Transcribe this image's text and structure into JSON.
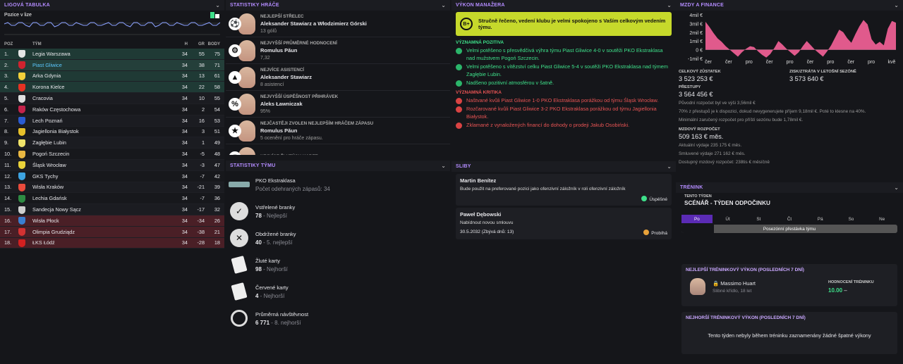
{
  "league": {
    "title": "LIGOVÁ TABULKA",
    "position_label": "Pozice v lize",
    "cols": {
      "pos": "POZ",
      "team": "TÝM",
      "p": "H",
      "gd": "GR",
      "pts": "BODY"
    },
    "rows": [
      {
        "pos": "1.",
        "team": "Legia Warszawa",
        "p": "34",
        "gd": "55",
        "pts": "75",
        "zone": "g",
        "crest": "#e5e5e5"
      },
      {
        "pos": "2.",
        "team": "Piast Gliwice",
        "p": "34",
        "gd": "38",
        "pts": "71",
        "zone": "gd",
        "crest": "#d0232f",
        "hl": true
      },
      {
        "pos": "3.",
        "team": "Arka Gdynia",
        "p": "34",
        "gd": "13",
        "pts": "61",
        "zone": "g",
        "crest": "#f2d03b"
      },
      {
        "pos": "4.",
        "team": "Korona Kielce",
        "p": "34",
        "gd": "22",
        "pts": "58",
        "zone": "g",
        "crest": "#e63223"
      },
      {
        "pos": "5.",
        "team": "Cracovia",
        "p": "34",
        "gd": "10",
        "pts": "55",
        "zone": "n",
        "crest": "#dfdfdf"
      },
      {
        "pos": "6.",
        "team": "Raków Częstochowa",
        "p": "34",
        "gd": "2",
        "pts": "54",
        "zone": "n2",
        "crest": "#c4234b"
      },
      {
        "pos": "7.",
        "team": "Lech Poznań",
        "p": "34",
        "gd": "16",
        "pts": "53",
        "zone": "n",
        "crest": "#2a5bd1"
      },
      {
        "pos": "8.",
        "team": "Jagiellonia Białystok",
        "p": "34",
        "gd": "3",
        "pts": "51",
        "zone": "n2",
        "crest": "#e6c02a"
      },
      {
        "pos": "9.",
        "team": "Zagłębie Lubin",
        "p": "34",
        "gd": "1",
        "pts": "49",
        "zone": "n",
        "crest": "#f0e36a"
      },
      {
        "pos": "10.",
        "team": "Pogoń Szczecin",
        "p": "34",
        "gd": "-5",
        "pts": "48",
        "zone": "n2",
        "crest": "#e9b842"
      },
      {
        "pos": "11.",
        "team": "Śląsk Wrocław",
        "p": "34",
        "gd": "-3",
        "pts": "47",
        "zone": "n",
        "crest": "#e9d23a"
      },
      {
        "pos": "12.",
        "team": "GKS Tychy",
        "p": "34",
        "gd": "-7",
        "pts": "42",
        "zone": "n2",
        "crest": "#3da3e0"
      },
      {
        "pos": "13.",
        "team": "Wisła Kraków",
        "p": "34",
        "gd": "-21",
        "pts": "39",
        "zone": "n",
        "crest": "#e94b3c"
      },
      {
        "pos": "14.",
        "team": "Lechia Gdańsk",
        "p": "34",
        "gd": "-7",
        "pts": "36",
        "zone": "n2",
        "crest": "#2e8b43"
      },
      {
        "pos": "15.",
        "team": "Sandecja Nowy Sącz",
        "p": "34",
        "gd": "-17",
        "pts": "32",
        "zone": "n",
        "crest": "#cfcfcf"
      },
      {
        "pos": "16.",
        "team": "Wisła Płock",
        "p": "34",
        "gd": "-34",
        "pts": "26",
        "zone": "r",
        "crest": "#3a7fd1"
      },
      {
        "pos": "17.",
        "team": "Olimpia Grudziądz",
        "p": "34",
        "gd": "-38",
        "pts": "21",
        "zone": "r",
        "crest": "#d23232"
      },
      {
        "pos": "18.",
        "team": "ŁKS Łódź",
        "p": "34",
        "gd": "-28",
        "pts": "18",
        "zone": "r",
        "crest": "#d32020"
      }
    ]
  },
  "player_stats": {
    "title": "STATISTIKY HRÁČE",
    "items": [
      {
        "label": "NEJLEPŠÍ STŘELEC",
        "name": "Aleksander Stawiarz a Włodzimierz Górski",
        "value": "13 gólů",
        "icon": "ball-icon"
      },
      {
        "label": "NEJVYŠŠÍ PRŮMĚRNÉ HODNOCENÍ",
        "name": "Romulus Păun",
        "value": "7,32",
        "icon": "gear-icon"
      },
      {
        "label": "NEJVÍCE ASISTENCÍ",
        "name": "Aleksander Stawiarz",
        "value": "8 asistencí",
        "icon": "assist-icon"
      },
      {
        "label": "NEJVYŠŠÍ ÚSPĚŠNOST PŘIHRÁVEK",
        "name": "Aleks Ławniczak",
        "value": "95%",
        "icon": "percent-icon"
      },
      {
        "label": "NEJČASTĚJI ZVOLEN NEJLEPŠÍM HRÁČEM ZÁPASU",
        "name": "Romulus Păun",
        "value": "5 ocenění pro hráče zápasu.",
        "icon": "star-icon"
      },
      {
        "label": "NEJVÍCE ŽLUTÝCH KARET",
        "name": "",
        "value": "",
        "icon": "card-icon"
      }
    ]
  },
  "team_stats": {
    "title": "STATISTIKY TÝMU",
    "items": [
      {
        "label": "PKO Ekstraklasa",
        "value": "",
        "rank": "Počet odehraných zápasů: 34",
        "icon": "league-icon"
      },
      {
        "label": "Vstřelené branky",
        "value": "78",
        "rank": " - Nejlepší",
        "icon": "goals-scored-icon"
      },
      {
        "label": "Obdržené branky",
        "value": "40",
        "rank": " - 5. nejlepší",
        "icon": "goals-conceded-icon"
      },
      {
        "label": "Žluté karty",
        "value": "98",
        "rank": " - Nejhorší",
        "icon": "yellow-card-icon"
      },
      {
        "label": "Červené karty",
        "value": "4",
        "rank": " - Nejhorší",
        "icon": "red-card-icon"
      },
      {
        "label": "Průměrná návštěvnost",
        "value": "6 771",
        "rank": " - 8. nejhorší",
        "icon": "attendance-icon"
      }
    ]
  },
  "manager": {
    "title": "VÝKON MANAŽERA",
    "grade": "B+",
    "verdict": "Stručně řečeno, vedení klubu je velmi spokojeno s Vaším celkovým vedením týmu.",
    "pos_title": "VÝZNAMNÁ POZITIVA",
    "positives": [
      "Velmi potěšeno s přesvědčivá výhra týmu Piast Gliwice 4-0 v soutěži PKO Ekstraklasa nad mužstvem Pogoń Szczecin.",
      "Velmi potěšeno s vítězství celku Piast Gliwice 5-4 v soutěži PKO Ekstraklasa nad týmem Zagłębie Lubin.",
      "Nadšeno pozitivní atmosférou v šatně."
    ],
    "neg_title": "VÝZNAMNÁ KRITIKA",
    "negatives": [
      "Naštvané kvůli Piast Gliwice 1-0 PKO Ekstraklasa porážkou od týmu Śląsk Wrocław.",
      "Rozčarované kvůli Piast Gliwice 3-2 PKO Ekstraklasa porážkou od týmu Jagiellonia Białystok.",
      "Zklamané z vynaložených financí do dohody o prodeji Jakub Osobiński."
    ]
  },
  "promises": {
    "title": "SLIBY",
    "items": [
      {
        "name": "Martin Benítez",
        "desc": "Bude použit na preferované pozici jako ofenzivní záložník v roli ofenzivní záložník",
        "date": "",
        "status": "Úspěšné",
        "status_color": "#3ee08a"
      },
      {
        "name": "Paweł Dębowski",
        "desc": "Nabídnout novou smlouvu",
        "date": "30.5.2032 (Zbývá dnů: 13)",
        "status": "Probíhá",
        "status_color": "#e8a23a"
      }
    ]
  },
  "finance": {
    "title": "MZDY A FINANCE",
    "y_ticks": [
      "4mil €",
      "3mil €",
      "2mil €",
      "1mil €",
      "0 €",
      "-1mil €"
    ],
    "x_ticks": [
      "čer",
      "čer",
      "pro",
      "čer",
      "pro",
      "čer",
      "pro",
      "čer",
      "pro",
      "kvě"
    ],
    "balance_label": "CELKOVÝ ZŮSTATEK",
    "balance": "3 523 253 €",
    "pl_label": "ZISK/ZTRÁTA V LETOŠNÍ SEZÓNĚ",
    "pl": "3 573 640 €",
    "transfer_label": "PŘESTUPY",
    "transfer": "3 564 456 €",
    "transfer_notes": [
      "Původní rozpočet byl ve výši 3,56mil €",
      "70% z přestupů je k dispozici, dokud nevygenerujete příjem 9,18mil €. Poté to klesne na 40%.",
      "Minimální zaručený rozpočet pro příští sezónu bude 1,78mil €."
    ],
    "wage_label": "MZDOVÝ ROZPOČET",
    "wage": "509 163 € měs.",
    "wage_notes": [
      "Aktuální výdaje 235 175 € měs.",
      "Smluvené výdaje 271 162 € měs.",
      "Dostupný mzdový rozpočet: 238tis € měsíčně"
    ]
  },
  "training": {
    "title": "TRÉNINK",
    "week_label": "TENTO TÝDEN",
    "scenario": "SCÉNÁŘ - TÝDEN ODPOČINKU",
    "days": [
      "Po",
      "Út",
      "St",
      "Čt",
      "Pá",
      "So",
      "Ne"
    ],
    "bar_text": "Posezónní přestávka týmu",
    "best_title": "NEJLEPŠÍ TRÉNINKOVÝ VÝKON (POSLEDNÍCH 7 DNÍ)",
    "best_name": "Massimo Huart",
    "best_pos": "Slibné křídlo, 18 let",
    "rating_label": "HODNOCENÍ TRÉNINKU",
    "rating": "10.00",
    "trend": "–",
    "worst_title": "NEJHORŠÍ TRÉNINKOVÝ VÝKON (POSLEDNÍCH 7 DNÍ)",
    "worst_text": "Tento týden nebyly během tréninku zaznamenány žádné špatné výkony"
  },
  "chart_data": {
    "type": "area",
    "title": "",
    "series": [
      {
        "name": "",
        "values": [
          3.2,
          2.6,
          1.9,
          1.3,
          0.9,
          0.4,
          0.0,
          -0.4,
          -0.8,
          -0.3,
          0.1,
          0.4,
          0.3,
          -0.2,
          -0.6,
          -0.9,
          -0.5,
          0.2,
          1.0,
          0.6,
          0.1,
          -0.3,
          -0.7,
          -0.3,
          0.4,
          1.0,
          0.5,
          0.0,
          -0.4,
          -0.8,
          -0.2,
          0.5,
          1.4,
          2.3,
          2.0,
          1.3,
          0.8,
          1.8,
          2.7,
          3.4,
          2.9,
          1.2,
          0.6,
          0.9,
          0.5,
          2.4,
          3.3,
          3.1
        ]
      }
    ],
    "ylim": [
      -1,
      4
    ]
  }
}
